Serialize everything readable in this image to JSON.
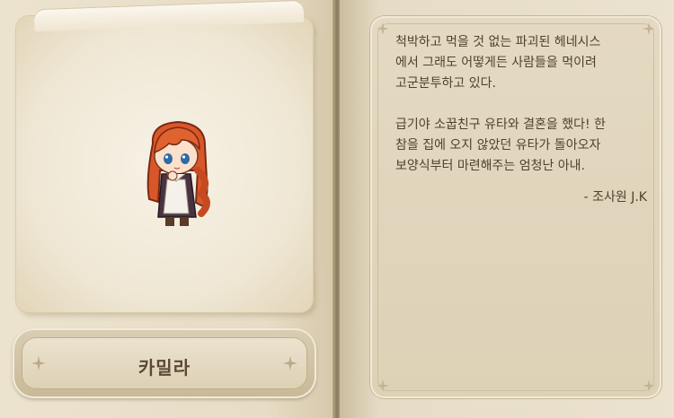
{
  "character": {
    "name": "카밀라"
  },
  "story": {
    "paragraphs": [
      "척박하고 먹을 것 없는 파괴된 헤네시스\n에서 그래도 어떻게든 사람들을 먹이려\n고군분투하고 있다.",
      "급기야 소꿉친구 유타와 결혼을 했다! 한\n참을 집에 오지 않았던 유타가 돌아오자\n보양식부터 마련해주는 엄청난 아내."
    ],
    "author": "- 조사원 J.K"
  },
  "colors": {
    "hair": "#d8572a",
    "dress": "#4a3340",
    "apron": "#f4f1ea",
    "text": "#4f4230"
  }
}
